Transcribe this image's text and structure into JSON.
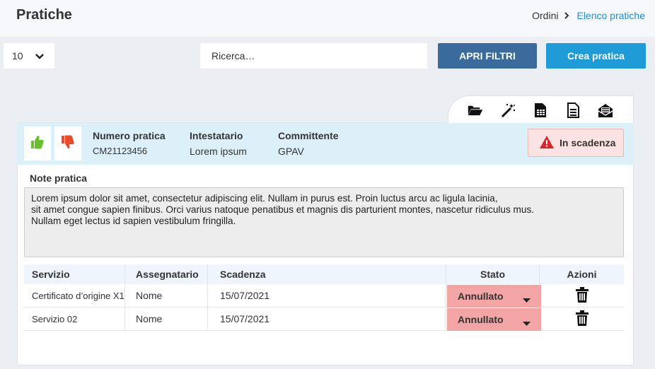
{
  "header": {
    "title": "Pratiche",
    "breadcrumb": [
      "Ordini",
      "Elenco pratiche"
    ]
  },
  "toolbar": {
    "page_size": "10",
    "search_placeholder": "Ricerca…",
    "filters_label": "APRI FILTRI",
    "create_label": "Crea pratica"
  },
  "card_icons": [
    "folder-open-icon",
    "magic-wand-icon",
    "spreadsheet-icon",
    "document-icon",
    "envelope-open-icon"
  ],
  "pratica": {
    "numero_label": "Numero pratica",
    "numero_value": "CM21123456",
    "intestatario_label": "Intestatario",
    "intestatario_value": "Lorem ipsum",
    "committente_label": "Committente",
    "committente_value": "GPAV",
    "status": "In scadenza"
  },
  "note": {
    "title": "Note pratica",
    "lines": [
      "Lorem ipsum dolor sit amet, consectetur adipiscing elit. Nullam in purus est. Proin luctus arcu ac ligula lacinia,",
      "sit amet congue sapien finibus. Orci varius natoque penatibus et magnis dis parturient montes, nascetur ridiculus mus.",
      "Nullam eget lectus id sapien vestibulum fringilla."
    ]
  },
  "table": {
    "headers": [
      "Servizio",
      "Assegnatario",
      "Scadenza",
      "Stato",
      "Azioni"
    ],
    "rows": [
      {
        "servizio": "Certificato d’origine X1",
        "assegnatario": "Nome",
        "scadenza": "15/07/2021",
        "stato": "Annullato"
      },
      {
        "servizio": "Servizio 02",
        "assegnatario": "Nome",
        "scadenza": "15/07/2021",
        "stato": "Annullato"
      }
    ]
  },
  "colors": {
    "filters_button": "#3b6b9c",
    "create_button": "#1f9bd7",
    "thumb_up": "#6abf2c",
    "thumb_down": "#e74c2c",
    "status_danger": "#d7262e",
    "stato_bg": "#f3a4a4"
  }
}
